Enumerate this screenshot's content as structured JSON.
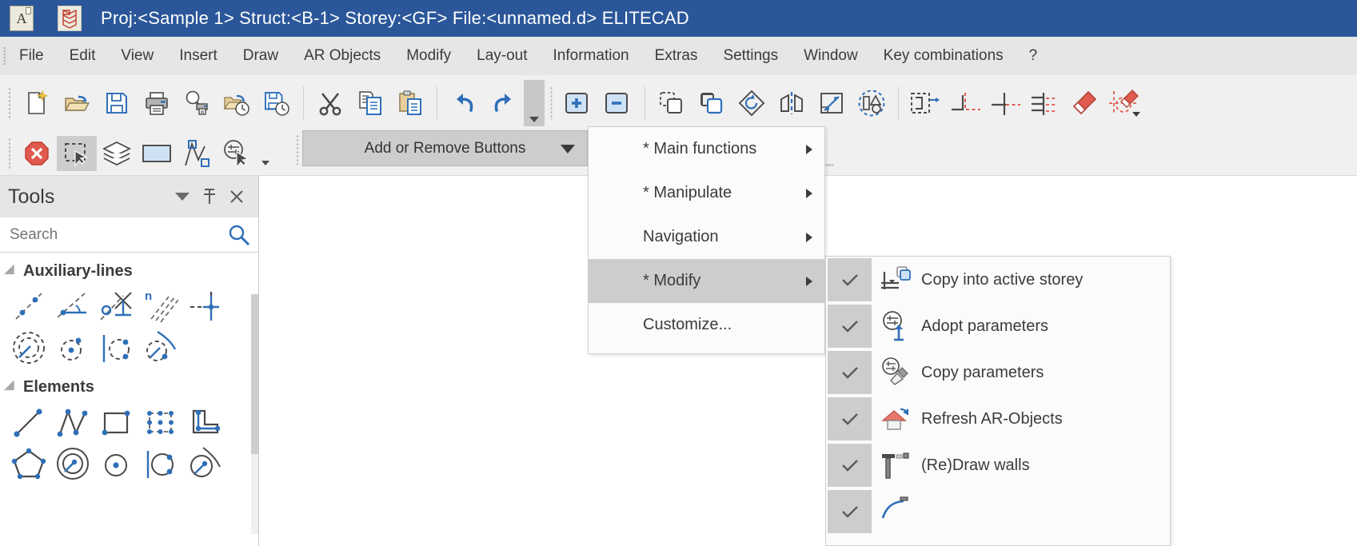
{
  "titlebar": {
    "app_icon": "document-a-icon",
    "logo_icon": "elitecad-logo-icon",
    "title": "Proj:<Sample 1> Struct:<B-1>  Storey:<GF>  File:<unnamed.d> ELITECAD"
  },
  "menubar": {
    "items": [
      {
        "label": "File"
      },
      {
        "label": "Edit"
      },
      {
        "label": "View"
      },
      {
        "label": "Insert"
      },
      {
        "label": "Draw"
      },
      {
        "label": "AR Objects"
      },
      {
        "label": "Modify"
      },
      {
        "label": "Lay-out"
      },
      {
        "label": "Information"
      },
      {
        "label": "Extras"
      },
      {
        "label": "Settings"
      },
      {
        "label": "Window"
      },
      {
        "label": "Key combinations"
      },
      {
        "label": "?"
      }
    ]
  },
  "toolbar_row1": {
    "icons": [
      "new-document-icon",
      "open-folder-icon",
      "save-icon",
      "print-icon",
      "print-preview-icon",
      "open-recent-icon",
      "save-recent-icon",
      "cut-icon",
      "copy-icon",
      "paste-icon",
      "undo-icon",
      "redo-icon"
    ],
    "overflow_label": "toolbar-overflow-chevron",
    "icons2": [
      "zoom-in-icon",
      "zoom-out-icon",
      "copy-to-layer-icon",
      "duplicate-icon",
      "rotate-icon",
      "mirror-icon",
      "scale-icon",
      "select-group-icon",
      "move-selection-icon",
      "trim-corner-icon",
      "trim-line-icon",
      "trim-multiple-icon",
      "eraser-icon",
      "delete-element-icon"
    ]
  },
  "toolbar_row2": {
    "icons": [
      "cancel-icon",
      "select-rectangle-icon",
      "layers-icon",
      "fill-rectangle-icon",
      "polyline-points-icon",
      "pick-parameters-icon"
    ],
    "active_index": 1
  },
  "add_remove_bar": {
    "label": "Add or Remove Buttons",
    "caret_icon": "chevron-down-icon"
  },
  "tools_panel": {
    "title": "Tools",
    "header_buttons": [
      "chevron-down-icon",
      "pin-icon",
      "close-icon"
    ],
    "search": {
      "placeholder": "Search",
      "value": "",
      "icon": "search-icon"
    },
    "groups": [
      {
        "name": "Auxiliary-lines",
        "collapse_icon": "triangle-collapse-icon",
        "icons": [
          "aux-line-2point-icon",
          "aux-line-angle-icon",
          "aux-line-perpendicular-icon",
          "aux-line-n-parallel-icon",
          "aux-line-offset-cross-icon",
          "aux-circle-concentric-icon",
          "aux-circle-center-icon",
          "aux-circle-tangent-line-icon",
          "aux-circle-tangent-arc-icon"
        ]
      },
      {
        "name": "Elements",
        "collapse_icon": "triangle-collapse-icon",
        "icons": [
          "line-icon",
          "polyline-icon",
          "rectangle-icon",
          "rectangle-points-icon",
          "lshape-icon",
          "polygon-icon",
          "circle-concentric-icon",
          "circle-center-icon",
          "circle-tangent-line-icon",
          "circle-tangent-arc-icon"
        ]
      }
    ]
  },
  "context_menu": {
    "items": [
      {
        "label": "* Main functions",
        "has_submenu": true,
        "highlighted": false
      },
      {
        "label": "* Manipulate",
        "has_submenu": true,
        "highlighted": false
      },
      {
        "label": "Navigation",
        "has_submenu": true,
        "highlighted": false
      },
      {
        "label": "* Modify",
        "has_submenu": true,
        "highlighted": true
      },
      {
        "label": "Customize...",
        "has_submenu": false,
        "highlighted": false
      }
    ]
  },
  "submenu": {
    "items": [
      {
        "label": "Copy into active storey",
        "checked": true,
        "icon": "copy-into-storey-icon"
      },
      {
        "label": "Adopt parameters",
        "checked": true,
        "icon": "adopt-parameters-icon"
      },
      {
        "label": "Copy parameters",
        "checked": true,
        "icon": "copy-parameters-icon"
      },
      {
        "label": "Refresh AR-Objects",
        "checked": true,
        "icon": "refresh-ar-objects-icon"
      },
      {
        "label": "(Re)Draw walls",
        "checked": true,
        "icon": "redraw-walls-icon"
      },
      {
        "label": "",
        "checked": true,
        "icon": "redraw-arc-icon"
      }
    ]
  },
  "colors": {
    "titlebar_blue": "#2b579a",
    "menubar_gray": "#e6e6e6",
    "toolbar_gray": "#f0f0f0",
    "highlight_gray": "#cdcdcd",
    "accent_blue": "#2f6fb8",
    "accent_red": "#e05a4f",
    "text_dark": "#3b3b3b",
    "folder_tan": "#e8cf9a"
  }
}
